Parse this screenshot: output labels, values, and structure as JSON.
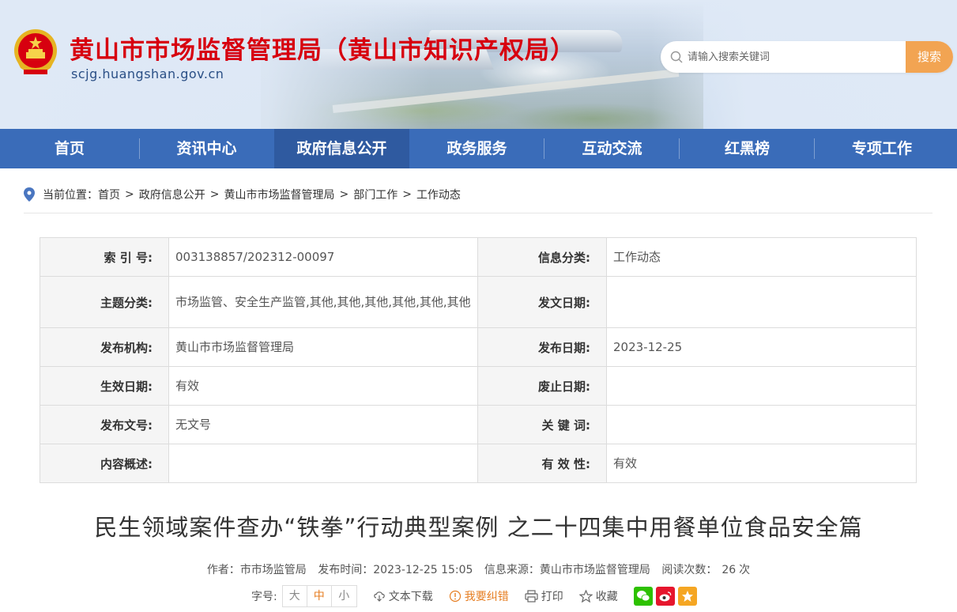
{
  "header": {
    "site_title": "黄山市市场监督管理局（黄山市知识产权局）",
    "site_domain": "scjg.huangshan.gov.cn",
    "search_placeholder": "请输入搜索关键词",
    "search_button": "搜索"
  },
  "nav": {
    "items": [
      {
        "label": "首页"
      },
      {
        "label": "资讯中心"
      },
      {
        "label": "政府信息公开"
      },
      {
        "label": "政务服务"
      },
      {
        "label": "互动交流"
      },
      {
        "label": "红黑榜"
      },
      {
        "label": "专项工作"
      }
    ],
    "active_index": 2
  },
  "breadcrumb": {
    "prefix": "当前位置：",
    "items": [
      "首页",
      "政府信息公开",
      "黄山市市场监督管理局",
      "部门工作",
      "工作动态"
    ],
    "separator": ">"
  },
  "info": {
    "index_no_label": "索 引 号:",
    "index_no": "003138857/202312-00097",
    "category_label": "信息分类:",
    "category": "工作动态",
    "topic_label": "主题分类:",
    "topic": "市场监管、安全生产监管,其他,其他,其他,其他,其他,其他",
    "doc_date_label": "发文日期:",
    "doc_date": "",
    "publisher_label": "发布机构:",
    "publisher": "黄山市市场监督管理局",
    "publish_date_label": "发布日期:",
    "publish_date": "2023-12-25",
    "effective_date_label": "生效日期:",
    "effective_date": "有效",
    "abolish_date_label": "废止日期:",
    "abolish_date": "",
    "doc_no_label": "发布文号:",
    "doc_no": "无文号",
    "keywords_label": "关 键 词:",
    "keywords": "",
    "summary_label": "内容概述:",
    "summary": "",
    "validity_label": "有 效 性:",
    "validity": "有效"
  },
  "article": {
    "title": "民生领域案件查办“铁拳”行动典型案例  之二十四集中用餐单位食品安全篇",
    "author_label": "作者：",
    "author": "市市场监管局",
    "time_label": "发布时间：",
    "time": "2023-12-25 15:05",
    "source_label": "信息来源：",
    "source": "黄山市市场监督管理局",
    "reads_label": "阅读次数：",
    "reads": "26",
    "reads_unit": "次"
  },
  "tools": {
    "font_label": "字号:",
    "font_sizes": [
      "大",
      "中",
      "小"
    ],
    "download": "文本下载",
    "correct": "我要纠错",
    "print": "打印",
    "favorite": "收藏"
  },
  "colors": {
    "nav_bg": "#3a6cb9",
    "nav_active": "#2f5aa0",
    "title_red": "#d7000f",
    "search_btn": "#f2a452",
    "accent_orange": "#e67e22"
  }
}
